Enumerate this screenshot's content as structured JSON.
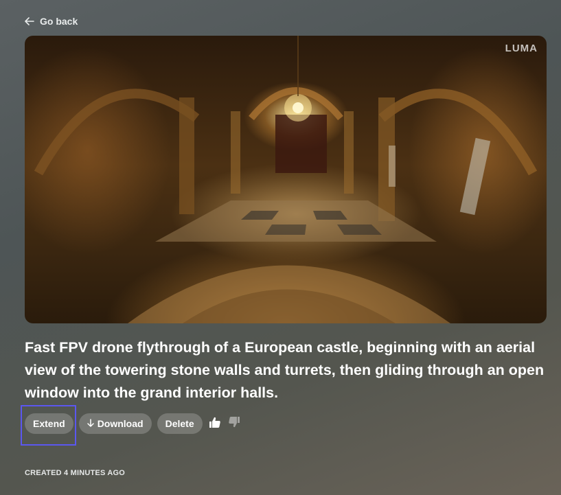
{
  "nav": {
    "back_label": "Go back",
    "back_icon": "arrow-left-icon"
  },
  "video": {
    "watermark": "LUMA"
  },
  "prompt": "Fast FPV drone flythrough of a European castle, beginning with an aerial view of the towering stone walls and turrets, then gliding through an open window into the grand interior halls.",
  "actions": {
    "extend_label": "Extend",
    "download_label": "Download",
    "download_icon": "arrow-down-icon",
    "delete_label": "Delete",
    "like_icon": "thumbs-up-icon",
    "dislike_icon": "thumbs-down-icon"
  },
  "meta": {
    "created": "CREATED 4 MINUTES AGO"
  },
  "colors": {
    "highlight": "#5b57f0"
  }
}
